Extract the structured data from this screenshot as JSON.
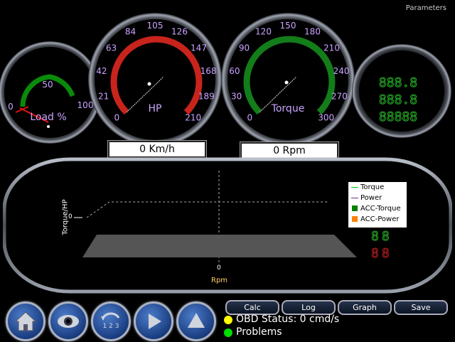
{
  "header": {
    "params_label": "Parameters"
  },
  "gauges": {
    "load": {
      "ticks": [
        "0",
        "50",
        "100"
      ],
      "label": "Load %",
      "value": 0
    },
    "hp": {
      "ticks": [
        "0",
        "21",
        "42",
        "63",
        "84",
        "105",
        "126",
        "147",
        "168",
        "189",
        "210"
      ],
      "label": "HP",
      "value": 0
    },
    "torque": {
      "ticks": [
        "0",
        "30",
        "60",
        "90",
        "120",
        "150",
        "180",
        "210",
        "240",
        "270",
        "300"
      ],
      "label": "Torque",
      "value": 0
    }
  },
  "readouts": {
    "speed": "0 Km/h",
    "rpm": "0 Rpm"
  },
  "digital": {
    "rows": [
      "888.8",
      "888.8",
      "88888"
    ],
    "small_green": "88",
    "small_red": "88"
  },
  "chart": {
    "ylabel": "Torque/HP",
    "xlabel": "Rpm",
    "y_tick": "0",
    "x_tick": "0",
    "legend": [
      {
        "name": "Torque",
        "color": "#00cc00",
        "kind": "line"
      },
      {
        "name": "Power",
        "color": "#663399",
        "kind": "line"
      },
      {
        "name": "ACC-Torque",
        "color": "#008000",
        "kind": "square"
      },
      {
        "name": "ACC-Power",
        "color": "#ff8000",
        "kind": "square"
      }
    ]
  },
  "buttons": {
    "calc": "Calc",
    "log": "Log",
    "graph": "Graph",
    "save": "Save"
  },
  "status": {
    "obd": "OBD Status: 0 cmd/s",
    "obd_color": "#ffff00",
    "problems": "Problems",
    "problems_color": "#00dd00"
  },
  "nav": [
    "home-icon",
    "eye-icon",
    "counter-icon",
    "play-icon",
    "up-arrow-icon"
  ]
}
